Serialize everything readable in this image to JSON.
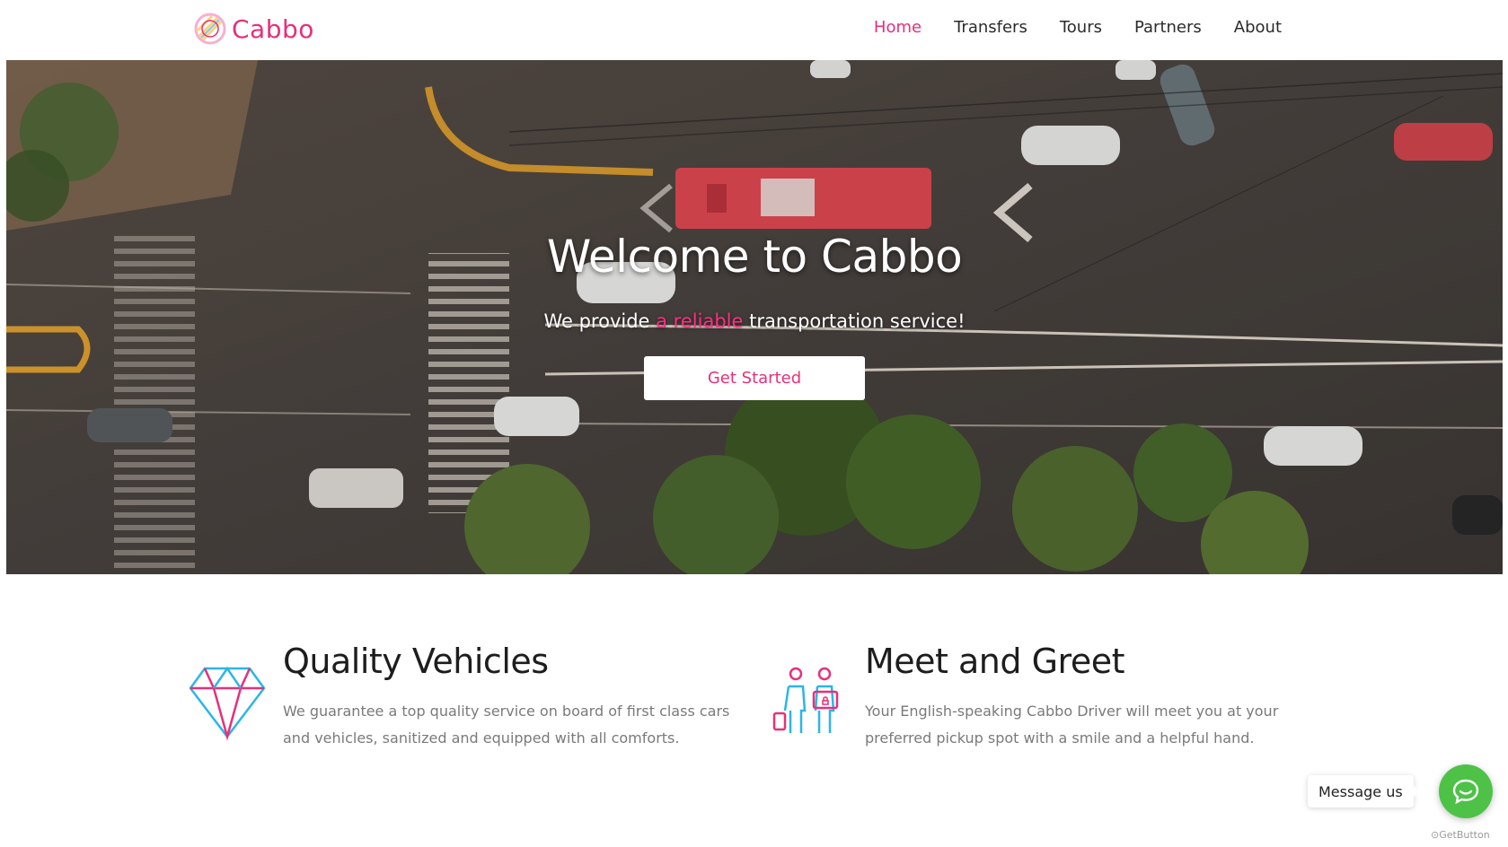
{
  "brand": {
    "name": "Cabbo",
    "accent_color": "#e6307a",
    "logo_icon": "gem-logo-icon"
  },
  "nav": [
    {
      "label": "Home",
      "active": true
    },
    {
      "label": "Transfers",
      "active": false
    },
    {
      "label": "Tours",
      "active": false
    },
    {
      "label": "Partners",
      "active": false
    },
    {
      "label": "About",
      "active": false
    }
  ],
  "hero": {
    "title": "Welcome to Cabbo",
    "subtitle_before": "We provide ",
    "subtitle_accent": "a reliable",
    "subtitle_after": " transportation service!",
    "cta_label": "Get Started"
  },
  "features": [
    {
      "icon": "diamond-icon",
      "title": "Quality Vehicles",
      "text": "We guarantee a top quality service on board of first class cars and vehicles, sanitized and equipped with all comforts."
    },
    {
      "icon": "meet-greet-icon",
      "title": "Meet and Greet",
      "text": "Your English-speaking Cabbo Driver will meet you at your preferred pickup spot with a smile and a helpful hand."
    }
  ],
  "chat": {
    "label": "Message us",
    "icon": "chat-bubble-icon",
    "color": "#4dc247",
    "powered_by": "GetButton"
  }
}
